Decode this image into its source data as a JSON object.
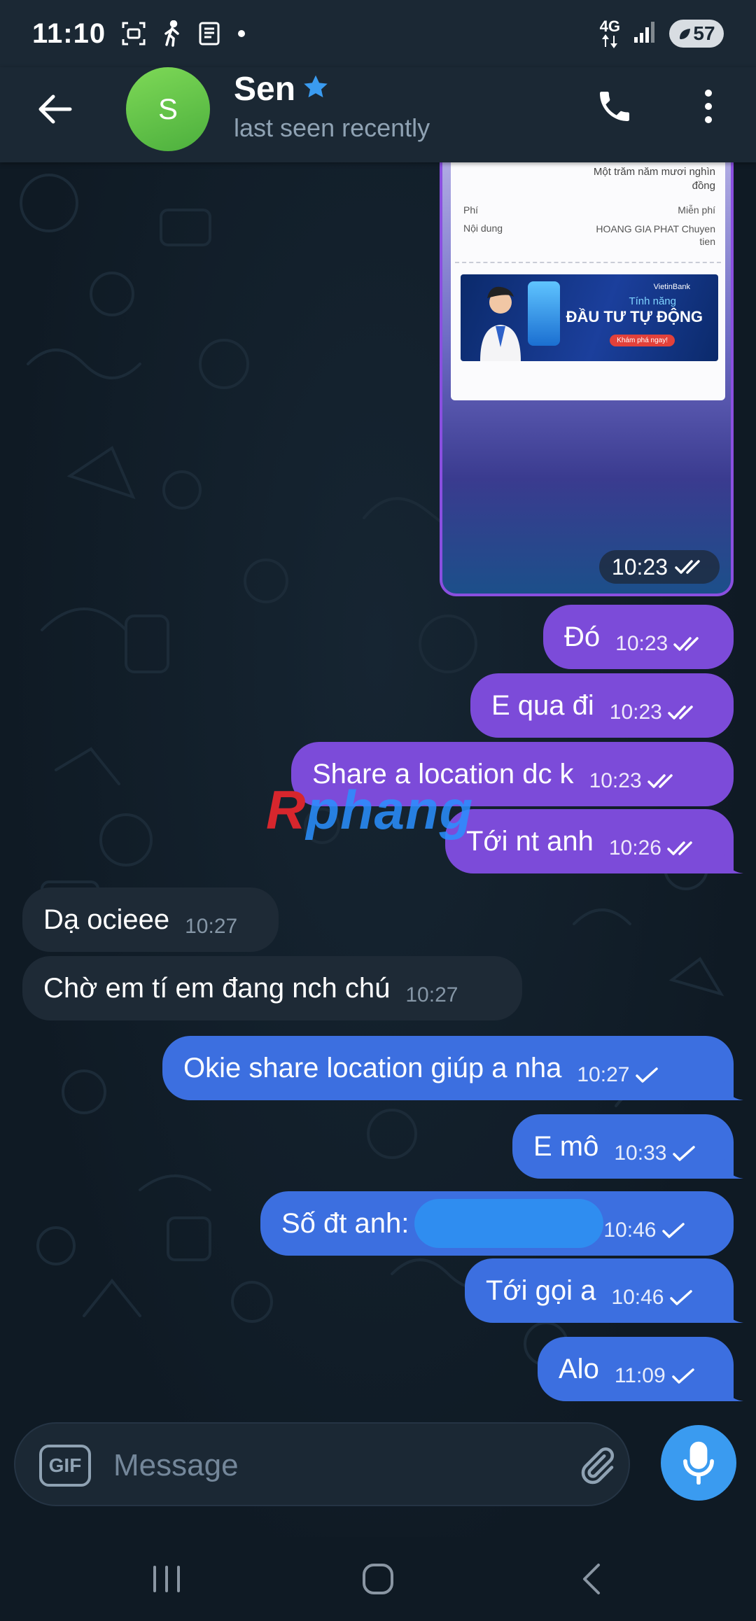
{
  "status_bar": {
    "time": "11:10",
    "network": "4G",
    "battery": "57",
    "icons": [
      "screenshot-icon",
      "walking-icon",
      "news-icon",
      "dot-icon",
      "data-arrows-icon",
      "signal-icon",
      "battery-icon"
    ]
  },
  "header": {
    "name": "Sen",
    "avatar_initial": "S",
    "status": "last seen recently",
    "avatar_color": "#6cc24a",
    "star_color": "#3a9bf0"
  },
  "image_message": {
    "amount_text": "Một trăm năm mươi nghìn đồng",
    "rows": [
      {
        "label": "Phí",
        "value": "Miễn phí"
      },
      {
        "label": "Nội dung",
        "value": "HOANG GIA PHAT Chuyen tien"
      }
    ],
    "ad": {
      "brand": "VietinBank",
      "line1": "Tính năng",
      "line2": "ĐẦU TƯ TỰ ĐỘNG",
      "cta": "Khám phá ngay!"
    },
    "time": "10:23",
    "status": "read"
  },
  "messages": [
    {
      "text": "Đó",
      "time": "10:23",
      "direction": "out",
      "status": "read"
    },
    {
      "text": "E qua đi",
      "time": "10:23",
      "direction": "out",
      "status": "read"
    },
    {
      "text": "Share a location dc k",
      "time": "10:23",
      "direction": "out",
      "status": "read"
    },
    {
      "text": "Tới nt anh",
      "time": "10:26",
      "direction": "out",
      "status": "read"
    },
    {
      "text": "Dạ ocieee",
      "time": "10:27",
      "direction": "in"
    },
    {
      "text": "Chờ em tí em đang nch chú",
      "time": "10:27",
      "direction": "in"
    },
    {
      "text": "Okie share location giúp a nha",
      "time": "10:27",
      "direction": "out",
      "status": "sent"
    },
    {
      "text": "E mô",
      "time": "10:33",
      "direction": "out",
      "status": "sent"
    },
    {
      "text": "Số đt anh:",
      "time": "10:46",
      "direction": "out",
      "status": "sent",
      "redacted": true
    },
    {
      "text": "Tới gọi a",
      "time": "10:46",
      "direction": "out",
      "status": "sent"
    },
    {
      "text": "Alo",
      "time": "11:09",
      "direction": "out",
      "status": "sent"
    }
  ],
  "watermark": {
    "part1": "R",
    "part2": "phang"
  },
  "composer": {
    "gif_label": "GIF",
    "placeholder": "Message"
  },
  "colors": {
    "purple_bubble": "#7c4bd9",
    "blue_bubble": "#3c6fe0",
    "incoming_bubble": "#1e2a36",
    "mic_button": "#3a9bf0"
  }
}
